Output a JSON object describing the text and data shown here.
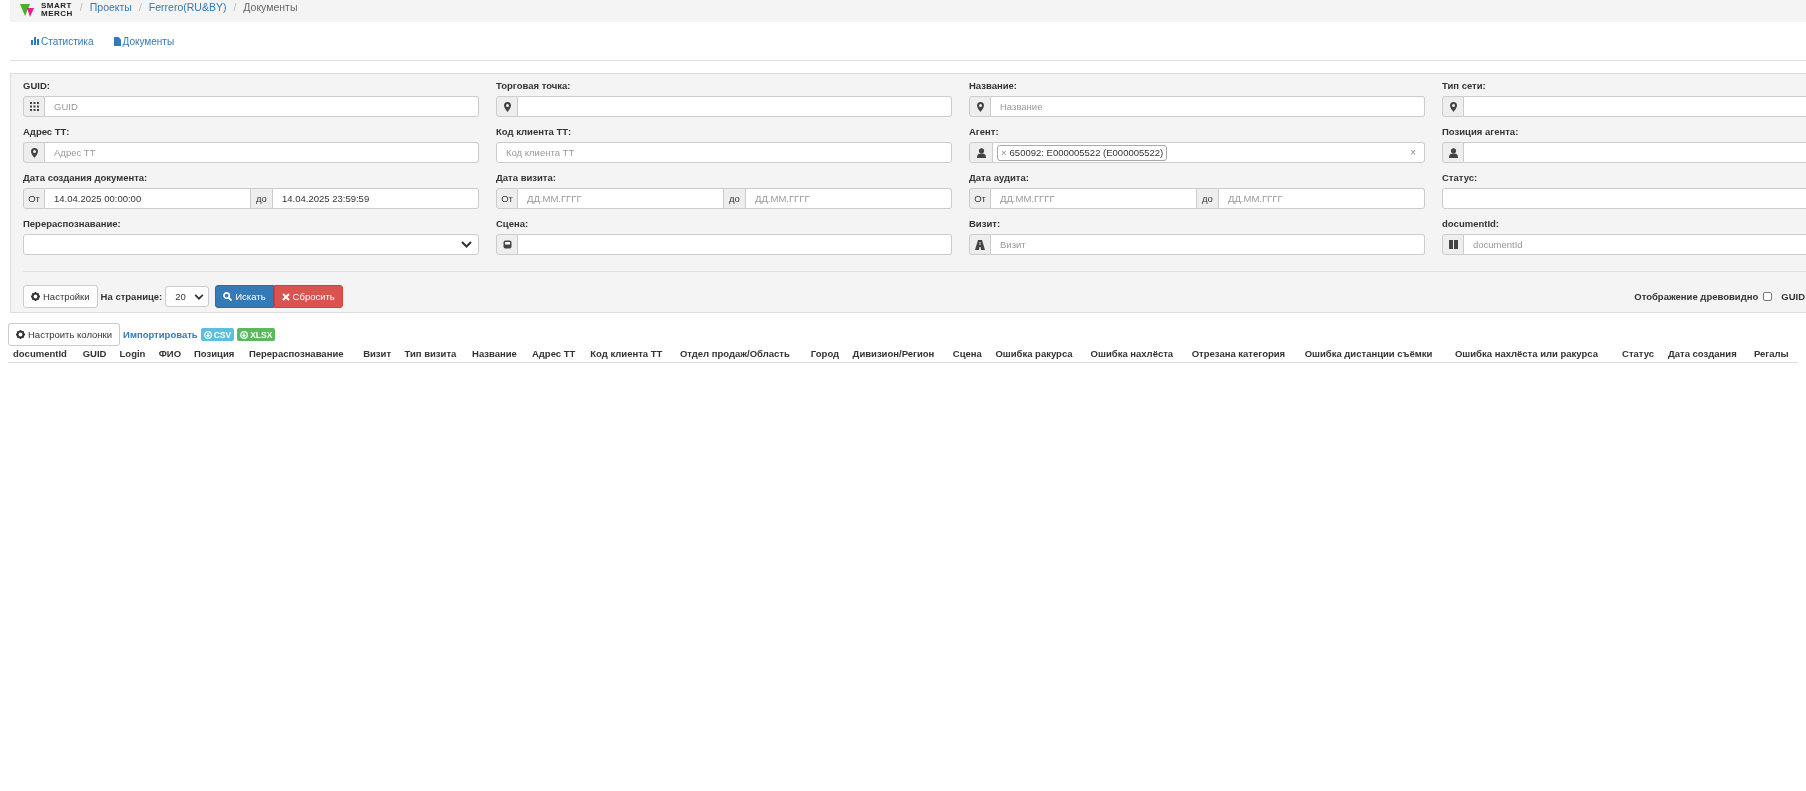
{
  "header": {
    "logo": [
      "SMART",
      "MERCH"
    ],
    "separator": "/",
    "breadcrumbs": [
      "Проекты",
      "Ferrero(RU&BY)",
      "Документы"
    ]
  },
  "nav_tabs": [
    {
      "label": "Статистика",
      "kind": "chart"
    },
    {
      "label": "Документы",
      "kind": "document"
    }
  ],
  "filters": [
    {
      "label": "GUID:",
      "kind": "input",
      "placeholder": "GUID"
    },
    {
      "label": "Торговая точка:",
      "kind": "input"
    },
    {
      "label": "Название:",
      "kind": "input",
      "placeholder": "Название"
    },
    {
      "label": "Тип сети:",
      "kind": "input"
    },
    {
      "label": "Адрес ТТ:",
      "kind": "input",
      "placeholder": "Адрес ТТ"
    },
    {
      "label": "Код клиента ТТ:",
      "kind": "input",
      "placeholder": "Код клиента ТТ"
    },
    {
      "label": "Агент:",
      "kind": "tags",
      "tags": [
        {
          "remove": "×",
          "text": "650092: E000005522 (E000005522)"
        }
      ],
      "clear": "×"
    },
    {
      "label": "Позиция агента:",
      "kind": "input"
    },
    {
      "label": "Дата создания документа:",
      "kind": "range",
      "from_label": "От",
      "from_value": "14.04.2025 00:00:00",
      "to_label": "до",
      "to_value": "14.04.2025 23:59:59"
    },
    {
      "label": "Дата визита:",
      "kind": "range",
      "from_label": "От",
      "from_placeholder": "ДД.ММ.ГГГГ",
      "to_label": "до",
      "to_placeholder": "ДД.ММ.ГГГГ"
    },
    {
      "label": "Дата аудита:",
      "kind": "range",
      "from_label": "От",
      "from_placeholder": "ДД.ММ.ГГГГ",
      "to_label": "до",
      "to_placeholder": "ДД.ММ.ГГГГ"
    },
    {
      "label": "Статус:",
      "kind": "input"
    },
    {
      "label": "Перераспознавание:",
      "kind": "select"
    },
    {
      "label": "Сцена:",
      "kind": "input"
    },
    {
      "label": "Визит:",
      "kind": "input",
      "placeholder": "Визит"
    },
    {
      "label": "documentId:",
      "kind": "input",
      "placeholder": "documentId"
    }
  ],
  "toolbar": {
    "settings_button": "Настройки",
    "per_page_label": "На странице:",
    "per_page_value": "20",
    "search_button": "Искать",
    "reset_button": "Сбросить",
    "tree_toggle": {
      "label": "Отображение древовидно",
      "checked": false
    },
    "guid_label": "GUID"
  },
  "table_toolbar": {
    "configure_button": "Настроить колонки",
    "import_label": "Импортировать",
    "export_buttons": [
      {
        "label": "CSV",
        "color": "#5bc0de"
      },
      {
        "label": "XLSX",
        "color": "#5cb85c"
      }
    ]
  },
  "table": {
    "columns": [
      "documentId",
      "GUID",
      "Login",
      "ФИО",
      "Позиция",
      "Перераспознавание",
      "Визит",
      "Тип визита",
      "Название",
      "Адрес ТТ",
      "Код клиента ТТ",
      "Отдел продаж/Область",
      "Город",
      "Дивизион/Регион",
      "Сцена",
      "Ошибка ракурса",
      "Ошибка нахлёста",
      "Отрезана категория",
      "Ошибка дистанции съёмки",
      "Ошибка нахлёста или ракурса",
      "Статус",
      "Дата создания",
      "Регалы"
    ]
  }
}
